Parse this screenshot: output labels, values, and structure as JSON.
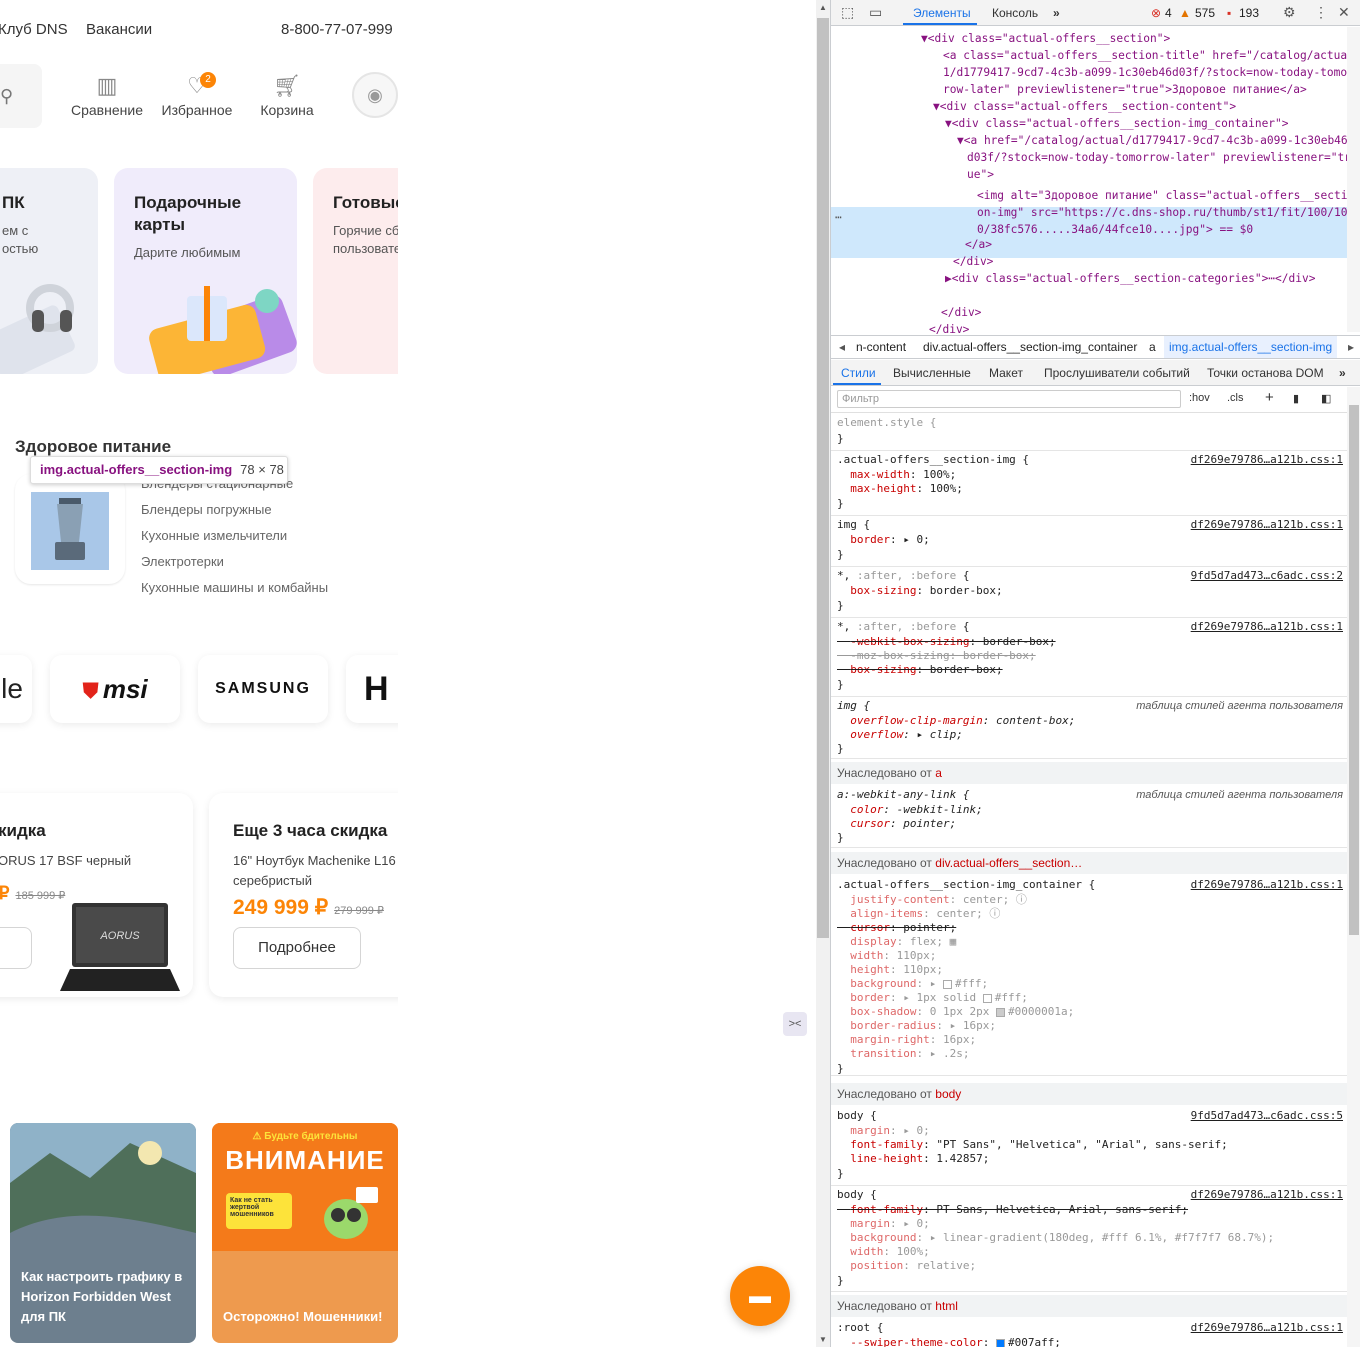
{
  "site": {
    "header": {
      "links": [
        "Клуб DNS",
        "Вакансии"
      ],
      "phone": "8-800-77-07-999",
      "icons": [
        {
          "label": "Сравнение",
          "icon": "compare-icon"
        },
        {
          "label": "Избранное",
          "icon": "heart-icon",
          "badge": "2"
        },
        {
          "label": "Корзина",
          "icon": "cart-icon"
        }
      ]
    },
    "cards": [
      {
        "title": "ПК",
        "subtitle": "ем с\nостью"
      },
      {
        "title": "Подарочные\nкарты",
        "subtitle": "Дарите любимым"
      },
      {
        "title": "Готовые",
        "subtitle": "Горячие сб\nпользовате"
      }
    ],
    "healthy_food": {
      "title": "Здоровое питание",
      "categories": [
        "Блендеры стационарные",
        "Блендеры погружные",
        "Кухонные измельчители",
        "Электротерки",
        "Кухонные машины и комбайны"
      ]
    },
    "tooltip": {
      "tag": "img",
      "cls": ".actual-offers__section-img",
      "dims": "78 × 78"
    },
    "brands": [
      "le",
      "msi",
      "SAMSUNG",
      "H"
    ],
    "deals": [
      {
        "title": "кидка",
        "name": "ORUS 17 BSF черный",
        "price": "",
        "old_price": "185 999 ₽",
        "button": "е"
      },
      {
        "title": "Еще 3 часа скидка",
        "name": "16\" Ноутбук Machenike L16 серебристый",
        "price": "249 999 ₽",
        "old_price": "279 999 ₽",
        "button": "Подробнее"
      }
    ],
    "promos": [
      {
        "caption": "Как настроить графику в Horizon Forbidden West для ПК"
      },
      {
        "caption": "Осторожно! Мошенники!",
        "banner": "ВНИМАНИЕ",
        "banner_top": "⚠ Будьте бдительны",
        "banner_side": "Как не стать жертвой мошенников"
      }
    ]
  },
  "devtools": {
    "tabs": [
      "Элементы",
      "Консоль"
    ],
    "counters": {
      "errors": "4",
      "warnings": "575",
      "info": "193"
    },
    "dom": [
      "▼<div class=\"actual-offers__section\">",
      "  <a class=\"actual-offers__section-title\" href=\"/catalog/actua",
      "  1/d1779417-9cd7-4c3b-a099-1c30eb46d03f/?stock=now-today-tomor",
      "  row-later\" previewlistener=\"true\">Здоровое питание</a>",
      "  ▼<div class=\"actual-offers__section-content\">",
      "    ▼<div class=\"actual-offers__section-img_container\">",
      "      ▼<a href=\"/catalog/actual/d1779417-9cd7-4c3b-a099-1c30eb46",
      "        d03f/?stock=now-today-tomorrow-later\" previewlistener=\"tr",
      "        ue\">",
      "          <img alt=\"Здоровое питание\" class=\"actual-offers__secti",
      "          on-img\" src=\"https://c.dns-shop.ru/thumb/st1/fit/100/10",
      "          0/38fc576.....34a6/44fce10....jpg\"> == $0",
      "        </a>",
      "      </div>",
      "    ▶<div class=\"actual-offers__section-categories\">⋯</div>",
      "    </div>",
      "  </div>"
    ],
    "breadcrumbs": [
      "n-content",
      "div.actual-offers__section-img_container",
      "a",
      "img.actual-offers__section-img"
    ],
    "style_tabs": [
      "Стили",
      "Вычисленные",
      "Макет",
      "Прослушиватели событий",
      "Точки останова DOM"
    ],
    "filter_placeholder": "Фильтр",
    "filter_buttons": [
      ":hov",
      ".cls"
    ],
    "inherited": {
      "a": "Унаследовано от",
      "a_el": "a",
      "div_el": "div.actual-offers__section…",
      "body_el": "body",
      "html_el": "html"
    },
    "sources": {
      "a": "df269e79786…a121b.css:1",
      "b": "9fd5d7ad473…c6adc.css:2",
      "c": "9fd5d7ad473…c6adc.css:5"
    },
    "ua_label": "таблица стилей агента пользователя"
  }
}
